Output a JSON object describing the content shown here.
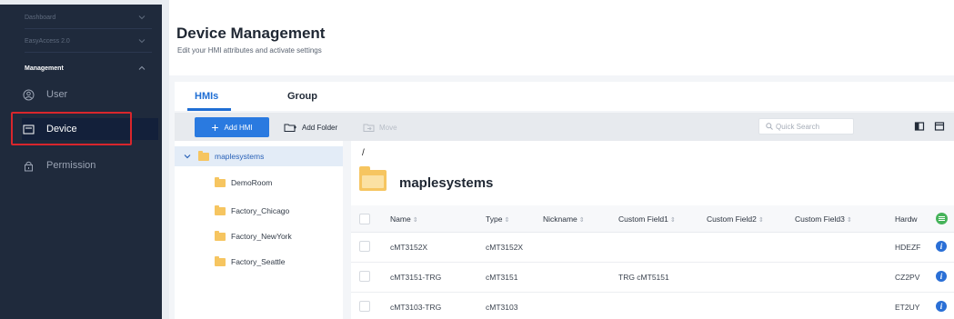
{
  "sidebar": {
    "sections": [
      {
        "label": "Dashboard"
      },
      {
        "label": "EasyAccess 2.0"
      }
    ],
    "management_label": "Management",
    "items": [
      {
        "label": "User",
        "icon": "user-icon"
      },
      {
        "label": "Device",
        "icon": "device-icon",
        "active": true
      },
      {
        "label": "Permission",
        "icon": "lock-icon"
      }
    ]
  },
  "header": {
    "title": "Device Management",
    "subtitle": "Edit your HMI attributes and activate settings"
  },
  "tabs": [
    {
      "label": "HMIs",
      "active": true
    },
    {
      "label": "Group",
      "active": false
    }
  ],
  "toolbar": {
    "add_label": "Add HMI",
    "add_folder_label": "Add Folder",
    "move_label": "Move",
    "search_placeholder": "Quick Search"
  },
  "tree": {
    "root": "maplesystems",
    "children": [
      "DemoRoom",
      "Factory_Chicago",
      "Factory_NewYork",
      "Factory_Seattle"
    ]
  },
  "main": {
    "path": "/",
    "folder_name": "maplesystems",
    "columns": [
      "Name",
      "Type",
      "Nickname",
      "Custom Field1",
      "Custom Field2",
      "Custom Field3",
      "Hardw"
    ],
    "rows": [
      {
        "name": "cMT3152X",
        "type": "cMT3152X",
        "nickname": "",
        "custom1": "",
        "custom2": "",
        "custom3": "",
        "hardware": "HDEZF"
      },
      {
        "name": "cMT3151-TRG",
        "type": "cMT3151",
        "nickname": "",
        "custom1": "TRG cMT5151",
        "custom2": "",
        "custom3": "",
        "hardware": "CZ2PV"
      },
      {
        "name": "cMT3103-TRG",
        "type": "cMT3103",
        "nickname": "",
        "custom1": "",
        "custom2": "",
        "custom3": "",
        "hardware": "ET2UY"
      }
    ]
  },
  "colors": {
    "sidebar_bg": "#1f2a3c",
    "accent": "#2a7ae0",
    "highlight_box": "#d9262c",
    "folder": "#f6c560"
  }
}
